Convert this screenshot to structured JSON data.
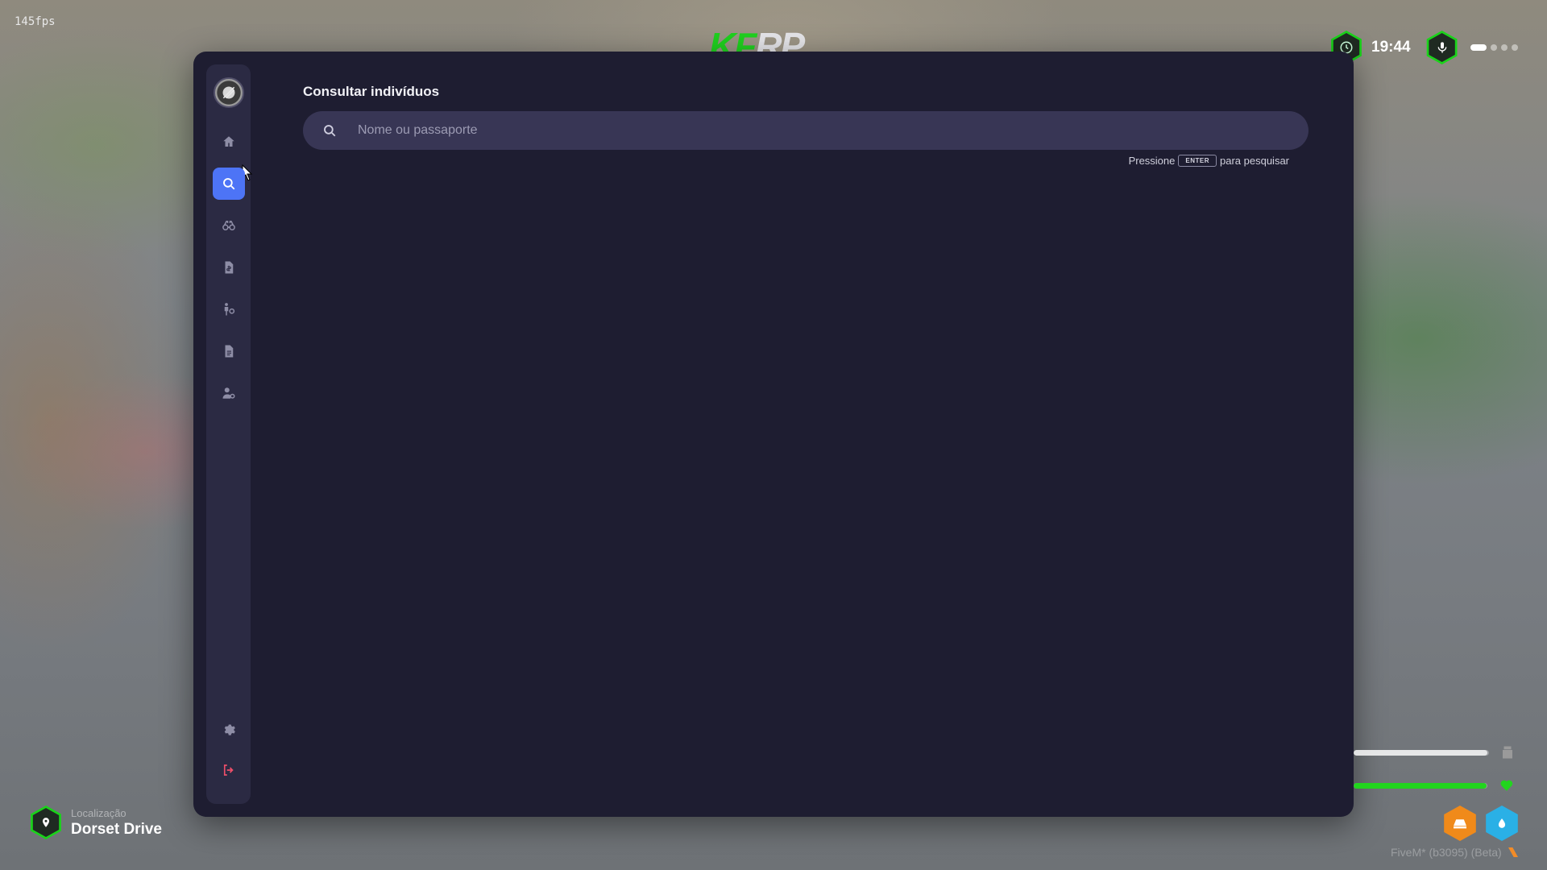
{
  "hud": {
    "fps": "145fps",
    "server_logo_primary": "KF",
    "server_logo_secondary": "RP",
    "time": "19:44",
    "voice_level_active": 1,
    "voice_level_total": 4
  },
  "tablet": {
    "sidebar": {
      "items": [
        {
          "name": "home",
          "icon": "home-icon",
          "active": false
        },
        {
          "name": "search",
          "icon": "search-icon",
          "active": true
        },
        {
          "name": "wanted",
          "icon": "binoculars-icon",
          "active": false
        },
        {
          "name": "penal-code",
          "icon": "file-dollar-icon",
          "active": false
        },
        {
          "name": "arrest",
          "icon": "person-handcuff-icon",
          "active": false
        },
        {
          "name": "reports",
          "icon": "document-icon",
          "active": false
        },
        {
          "name": "officers",
          "icon": "user-gear-icon",
          "active": false
        }
      ],
      "settings_icon": "gear-icon",
      "logout_icon": "logout-icon"
    },
    "main": {
      "title": "Consultar indivíduos",
      "search": {
        "placeholder": "Nome ou passaporte",
        "value": ""
      },
      "hint": {
        "before": "Pressione",
        "key": "ENTER",
        "after": "para pesquisar"
      }
    }
  },
  "location": {
    "label": "Localização",
    "name": "Dorset Drive"
  },
  "status": {
    "armor_level": 0.99,
    "health_level": 0.99,
    "hunger_icon": "food-icon",
    "thirst_icon": "water-drop-icon"
  },
  "footer": {
    "brand": "FiveM* (b3095) (Beta)"
  },
  "colors": {
    "accent": "#4d74f6",
    "panel_bg": "#1e1d31",
    "sidebar_bg": "#2b2a43",
    "search_bg": "#383655",
    "hud_green": "#1ad31a",
    "logout_red": "#ef4f6a",
    "health_green": "#22d51e",
    "hunger_orange": "#f08a1a",
    "thirst_blue": "#2ab0e6"
  }
}
